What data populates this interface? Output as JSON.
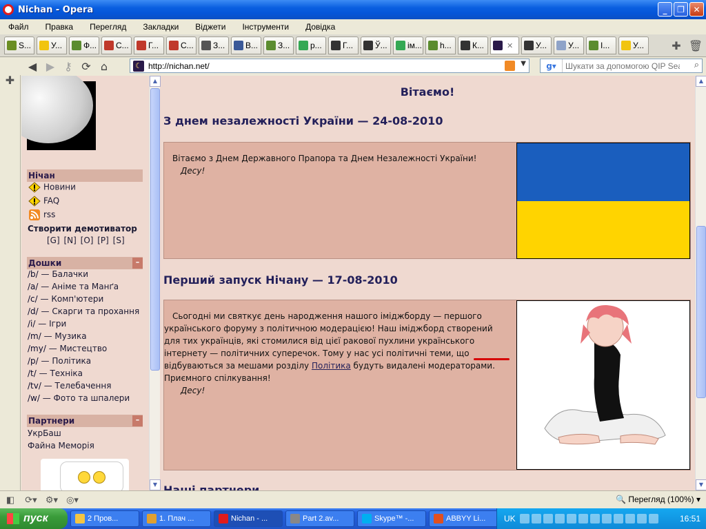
{
  "window": {
    "title": "Nichan - Opera"
  },
  "menu": {
    "items": [
      "Файл",
      "Правка",
      "Перегляд",
      "Закладки",
      "Віджети",
      "Інструменти",
      "Довідка"
    ]
  },
  "tabs": [
    {
      "label": "S...",
      "icon_color": "#6b8e23"
    },
    {
      "label": "У...",
      "icon_color": "#f1c40f"
    },
    {
      "label": "Ф...",
      "icon_color": "#5b8c2f"
    },
    {
      "label": "С...",
      "icon_color": "#c0392b"
    },
    {
      "label": "Г...",
      "icon_color": "#c0392b"
    },
    {
      "label": "С...",
      "icon_color": "#c0392b"
    },
    {
      "label": "З...",
      "icon_color": "#555555"
    },
    {
      "label": "В...",
      "icon_color": "#3b5998"
    },
    {
      "label": "З...",
      "icon_color": "#5b8c2f"
    },
    {
      "label": "р...",
      "icon_color": "#34a853"
    },
    {
      "label": "Г...",
      "icon_color": "#333333"
    },
    {
      "label": "Ў...",
      "icon_color": "#333333"
    },
    {
      "label": "ім...",
      "icon_color": "#34a853"
    },
    {
      "label": "h...",
      "icon_color": "#5b8c2f"
    },
    {
      "label": "К...",
      "icon_color": "#333333"
    },
    {
      "label": "",
      "icon_color": "#2a1a4a",
      "active": true
    },
    {
      "label": "У...",
      "icon_color": "#333333"
    },
    {
      "label": "У...",
      "icon_color": "#8fa3c8"
    },
    {
      "label": "І...",
      "icon_color": "#5b8c2f"
    },
    {
      "label": "У...",
      "icon_color": "#f1c40f"
    }
  ],
  "address": {
    "url": "http://nichan.net/"
  },
  "search": {
    "placeholder": "Шукати за допомогою QIP Search"
  },
  "sidebar": {
    "section_title": "Нічан",
    "links": [
      {
        "label": "Новини",
        "icon": "warning-icon"
      },
      {
        "label": "FAQ",
        "icon": "warning-icon"
      },
      {
        "label": "rss",
        "icon": "rss-icon"
      }
    ],
    "demotivator": "Створити демотиватор",
    "demot_links": "[G] [N] [O] [P] [S]",
    "boards_title": "Дошки",
    "boards": [
      {
        "slug": "/b/",
        "name": "— Балачки"
      },
      {
        "slug": "/a/",
        "name": "— Аніме та Манґа"
      },
      {
        "slug": "/c/",
        "name": "— Комп'ютери"
      },
      {
        "slug": "/d/",
        "name": "— Скарги та прохання"
      },
      {
        "slug": "/i/",
        "name": "— Ігри"
      },
      {
        "slug": "/m/",
        "name": "— Музика"
      },
      {
        "slug": "/my/",
        "name": "— Мистецтво"
      },
      {
        "slug": "/p/",
        "name": "— Політика"
      },
      {
        "slug": "/t/",
        "name": "— Техніка"
      },
      {
        "slug": "/tv/",
        "name": "— Телебачення"
      },
      {
        "slug": "/w/",
        "name": "— Фото та шпалери"
      }
    ],
    "partners_title": "Партнери",
    "partners": [
      "УкрБаш",
      "Файна Меморія"
    ],
    "minimize": "–"
  },
  "content": {
    "welcome": "Вітаємо!",
    "news1": {
      "title": "З днем незалежності України — 24-08-2010",
      "text": "Вітаємо з Днем Державного Прапора та Днем Незалежності України!",
      "sig": "Десу!"
    },
    "news2": {
      "title": "Перший запуск Нічану — 17-08-2010",
      "text_before": "Сьогодні ми святкує день народження нашого іміджборду — першого українського форуму з політичною модерацією! Наш іміджборд створений для тих українців, які стомилися від цієї ракової пухлини українського інтернету — політичних суперечок. Тому у нас усі політичні теми, що відбуваються за мешами розділу ",
      "link": "Політика",
      "text_after": " будуть видалені модераторами. Приємного спілкування!",
      "sig": "Десу!"
    },
    "partners_title": "Наші партнери"
  },
  "status": {
    "zoom": "Перегляд (100%)"
  },
  "taskbar": {
    "start": "пуск",
    "tasks": [
      "2 Пров...",
      "1. Плач ...",
      "Nichan - ...",
      "Part 2.av...",
      "Skype™ -...",
      "ABBYY Li..."
    ],
    "lang": "UK",
    "clock": "16:51"
  }
}
